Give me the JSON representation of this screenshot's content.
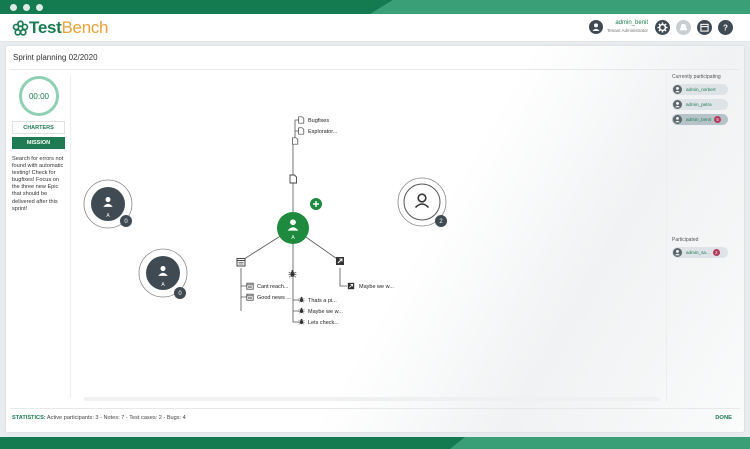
{
  "app": {
    "logo_test": "Test",
    "logo_bench": "Bench",
    "brand_color": "#1d7a52",
    "accent_color": "#e7a33a"
  },
  "header": {
    "user_name": "admin_benit",
    "user_role": "Tenant Administrator",
    "icons": [
      "settings-icon",
      "notifications-icon",
      "calendar-icon",
      "help-icon"
    ]
  },
  "page": {
    "title": "Sprint planning 02/2020"
  },
  "left_panel": {
    "timer": "00:00",
    "tab_charters": "CHARTERS",
    "tab_mission": "MISSION",
    "mission_text": "Search for errors not found with automatic testing! Check for bugfixes! Focus on the three new Epic that should be delivered after this sprint!"
  },
  "canvas": {
    "participants": [
      {
        "letter": "A",
        "count": "0"
      },
      {
        "letter": "A",
        "count": "0"
      },
      {
        "letter": "",
        "count": "2"
      }
    ],
    "center": {
      "letter": "A"
    },
    "charters": [
      "Bugfixes",
      "Explorator..."
    ],
    "notes": [
      "Cant reach...",
      "Good news ..."
    ],
    "bugs": [
      "Thats a pi...",
      "Maybe we w...",
      "Lets check..."
    ],
    "test_cases": [
      "Maybe we w..."
    ]
  },
  "right_panel": {
    "currently_title": "Currently participating",
    "current": [
      {
        "name": "admin_norbert",
        "badge": ""
      },
      {
        "name": "admin_petra",
        "badge": ""
      },
      {
        "name": "admin_benit",
        "badge": "5"
      }
    ],
    "participated_title": "Participated",
    "participated": [
      {
        "name": "admin_sa...",
        "badge": "2"
      }
    ]
  },
  "footer": {
    "stats_label": "STATISTICS:",
    "stats_text": "Active participants: 3 - Notes: 7 - Test cases: 2 - Bugs: 4",
    "done_label": "DONE"
  }
}
